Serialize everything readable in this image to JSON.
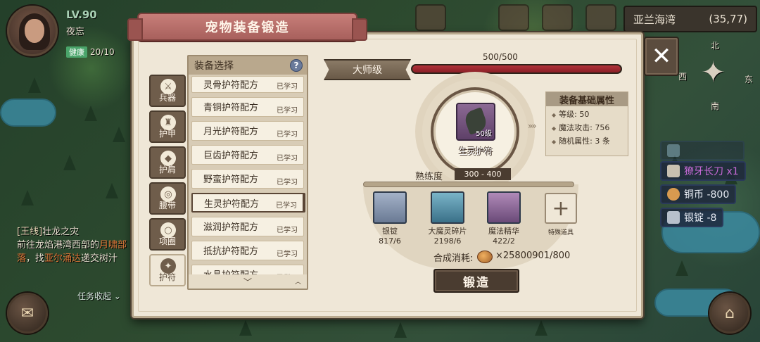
{
  "hud": {
    "level": "LV.90",
    "player_name": "夜忘",
    "health_label": "健康",
    "health_value": "20/10"
  },
  "quest": {
    "tag": "[王线]",
    "title": "壮龙之灾",
    "text_1": "前往龙焰港湾西部的",
    "hl_1": "月啸部落",
    "text_2": "，找",
    "hl_2": "亚尔涌达",
    "text_3": "递交树汁",
    "collapse_label": "任务收起"
  },
  "location": {
    "name": "亚兰海湾",
    "coords": "(35,77)"
  },
  "compass": {
    "north": "北",
    "east": "东",
    "south": "南",
    "west": "西"
  },
  "loot": [
    {
      "text": "獠牙长刀 x1",
      "color": "#c86ad8"
    },
    {
      "text": "铜币 -800",
      "color": "#f0f0f0"
    },
    {
      "text": "银锭 -8",
      "color": "#f0f0f0"
    }
  ],
  "dialog": {
    "title": "宠物装备锻造",
    "close_label": "✕",
    "categories": [
      {
        "label": "兵器",
        "icon": "sword-icon",
        "glyph": "⚔"
      },
      {
        "label": "护甲",
        "icon": "armor-icon",
        "glyph": "♜"
      },
      {
        "label": "护肩",
        "icon": "shoulder-icon",
        "glyph": "◆"
      },
      {
        "label": "腰带",
        "icon": "belt-icon",
        "glyph": "◎"
      },
      {
        "label": "项圈",
        "icon": "collar-icon",
        "glyph": "○"
      },
      {
        "label": "护符",
        "icon": "amulet-icon",
        "glyph": "✦",
        "active": true
      }
    ],
    "list_header": "装备选择",
    "help_icon": "?",
    "recipes": [
      {
        "name": "灵骨护符配方",
        "state": "已学习"
      },
      {
        "name": "青铜护符配方",
        "state": "已学习"
      },
      {
        "name": "月光护符配方",
        "state": "已学习"
      },
      {
        "name": "巨齿护符配方",
        "state": "已学习"
      },
      {
        "name": "野蛮护符配方",
        "state": "已学习"
      },
      {
        "name": "生灵护符配方",
        "state": "已学习",
        "selected": true
      },
      {
        "name": "滋润护符配方",
        "state": "已学习"
      },
      {
        "name": "抵抗护符配方",
        "state": "已学习"
      },
      {
        "name": "水晶护符配方",
        "state": "已学习"
      }
    ],
    "grade": "大师级",
    "progress_text": "500/500",
    "progress_fraction": 1.0,
    "item": {
      "name": "生灵护符",
      "level": "50级"
    },
    "attributes": {
      "title": "装备基础属性",
      "lines": [
        "等级: 50",
        "魔法攻击: 756",
        "随机属性: 3 条"
      ]
    },
    "proficiency_label": "熟练度",
    "proficiency_range": "300 - 400",
    "materials": [
      {
        "name": "银锭",
        "count": "817/6",
        "color": "#7a8aa4"
      },
      {
        "name": "大魔灵碎片",
        "count": "2198/6",
        "color": "#5a90a8"
      },
      {
        "name": "魔法精华",
        "count": "422/2",
        "color": "#8c6a94"
      }
    ],
    "special_item_label": "特殊道具",
    "cost_label": "合成消耗:",
    "cost_value": "×25800901/800",
    "forge_label": "锻造"
  }
}
